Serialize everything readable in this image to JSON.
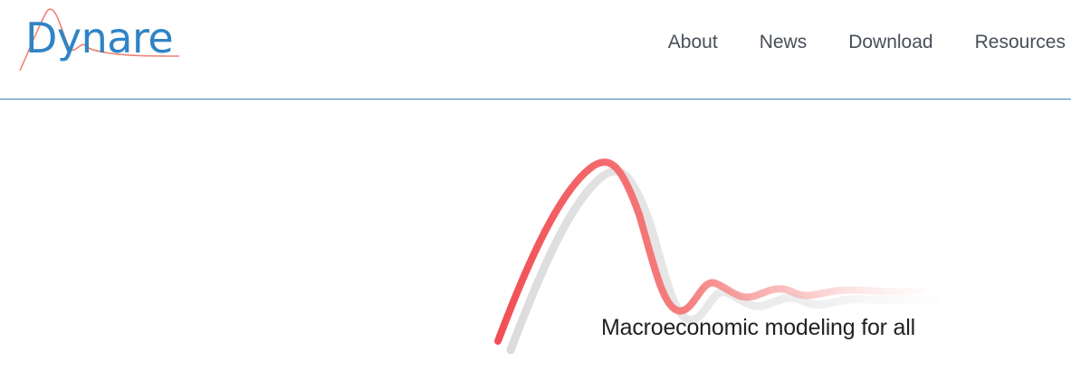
{
  "brand": {
    "name": "Dynare",
    "logo_text_color": "#2f84c6",
    "logo_wave_color": "#f08070"
  },
  "nav": {
    "items": [
      {
        "label": "About"
      },
      {
        "label": "News"
      },
      {
        "label": "Download"
      },
      {
        "label": "Resources"
      }
    ]
  },
  "hero": {
    "tagline": "Macroeconomic modeling for all",
    "curve_color": "#f25c5c",
    "shadow_color": "#d9d9d9"
  },
  "header_rule_color": "#3f86c0"
}
